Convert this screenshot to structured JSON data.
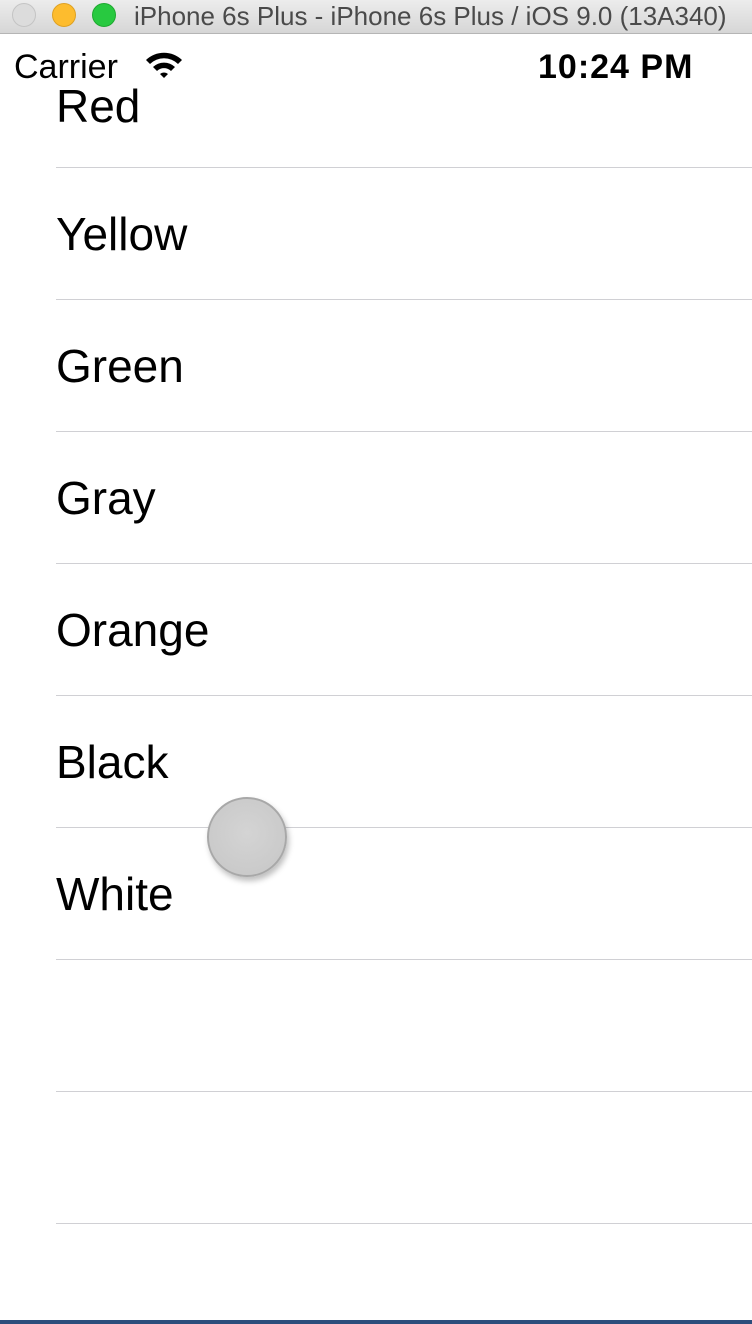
{
  "window": {
    "title": "iPhone 6s Plus - iPhone 6s Plus / iOS 9.0 (13A340)"
  },
  "status_bar": {
    "carrier": "Carrier",
    "signal_icon": "wifi-icon",
    "time": "10:24 PM"
  },
  "table": {
    "rows": [
      {
        "label": "Red"
      },
      {
        "label": "Yellow"
      },
      {
        "label": "Green"
      },
      {
        "label": "Gray"
      },
      {
        "label": "Orange"
      },
      {
        "label": "Black"
      },
      {
        "label": "White"
      },
      {
        "label": ""
      },
      {
        "label": ""
      }
    ]
  },
  "colors": {
    "separator": "#d0d0d4",
    "text": "#000000",
    "background": "#ffffff"
  }
}
